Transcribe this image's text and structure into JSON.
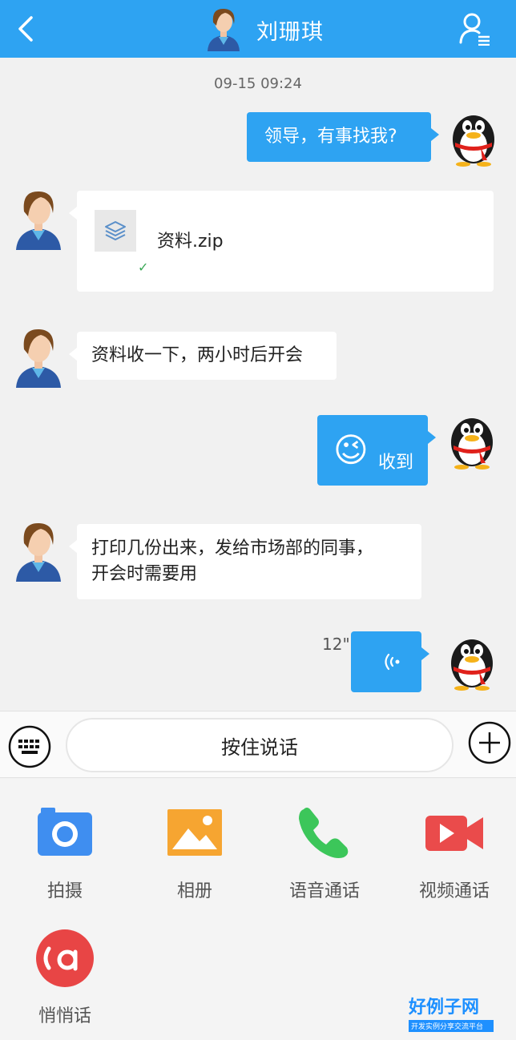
{
  "header": {
    "title": "刘珊琪"
  },
  "chat": {
    "timestamp": "09-15 09:24",
    "messages": [
      {
        "from": "me",
        "type": "text",
        "text": "领导，有事找我?"
      },
      {
        "from": "contact",
        "type": "file",
        "file_name": "资料.zip",
        "status": "✓"
      },
      {
        "from": "contact",
        "type": "text",
        "text": "资料收一下，两小时后开会"
      },
      {
        "from": "me",
        "type": "emoji_text",
        "emoji": "😉",
        "text": "收到"
      },
      {
        "from": "contact",
        "type": "text",
        "lines": [
          "打印几份出来，发给市场部的同事，",
          "开会时需要用"
        ]
      },
      {
        "from": "me",
        "type": "voice",
        "duration": "12\""
      }
    ]
  },
  "input_bar": {
    "hold_to_talk_label": "按住说话"
  },
  "panel": {
    "items": [
      {
        "label": "拍摄",
        "icon": "camera-icon",
        "color": "#3f8ef0"
      },
      {
        "label": "相册",
        "icon": "photo-album-icon",
        "color": "#f6a531"
      },
      {
        "label": "语音通话",
        "icon": "phone-icon",
        "color": "#3cc65a"
      },
      {
        "label": "视频通话",
        "icon": "video-call-icon",
        "color": "#ea4b4b"
      },
      {
        "label": "悄悄话",
        "icon": "whisper-icon",
        "color": "#e84545"
      }
    ]
  },
  "colors": {
    "accent": "#2ea3f2",
    "background": "#f1f1f1"
  },
  "watermark": {
    "brand": "好例子网",
    "tagline": "开发实例分享交流平台"
  }
}
